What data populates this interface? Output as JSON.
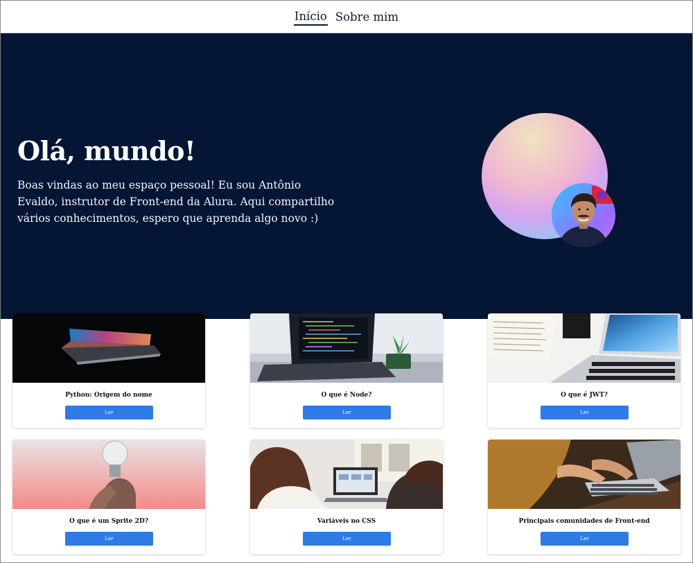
{
  "nav": {
    "items": [
      {
        "label": "Início",
        "active": true
      },
      {
        "label": "Sobre mim",
        "active": false
      }
    ]
  },
  "hero": {
    "title": "Olá, mundo!",
    "text": "Boas vindas ao meu espaço pessoal! Eu sou Antônio Evaldo, instrutor de Front-end da Alura. Aqui compartilho vários conhecimentos, espero que aprenda algo novo :)"
  },
  "colors": {
    "hero_bg": "#041634",
    "button": "#2f7be6",
    "text_dark": "#0b1733"
  },
  "cards": [
    {
      "title": "Python: Origem do nome",
      "button": "Ler",
      "image": "laptop-dark-rainbow"
    },
    {
      "title": "O que é Node?",
      "button": "Ler",
      "image": "laptop-code-plant"
    },
    {
      "title": "O que é JWT?",
      "button": "Ler",
      "image": "laptop-book-desk"
    },
    {
      "title": "O que é um Sprite 2D?",
      "button": "Ler",
      "image": "hand-lightbulb"
    },
    {
      "title": "Variáveis no CSS",
      "button": "Ler",
      "image": "people-laptop-office"
    },
    {
      "title": "Principais comunidades de Front-end",
      "button": "Ler",
      "image": "typing-laptop-wood-desk"
    }
  ]
}
